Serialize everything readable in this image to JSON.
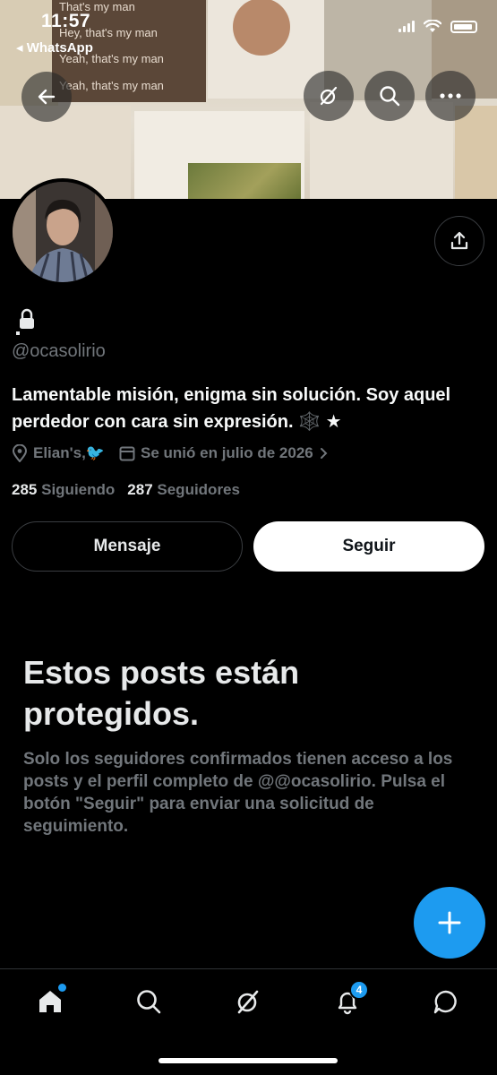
{
  "status_bar": {
    "time": "11:57",
    "back_app": "◂ WhatsApp"
  },
  "banner": {
    "chat_lines": [
      "That's my man",
      "Hey, that's my man",
      "Yeah, that's my man",
      "Yeah, that's my man"
    ]
  },
  "profile": {
    "handle": "@ocasolirio",
    "bio": "Lamentable misión, enigma sin solución. Soy aquel perdedor con cara sin expresión. 🕸️ ★",
    "location": "Elian's,🐦",
    "joined": "Se unió en julio de 2026",
    "following_count": "285",
    "following_label": "Siguiendo",
    "followers_count": "287",
    "followers_label": "Seguidores"
  },
  "actions": {
    "message_label": "Mensaje",
    "follow_label": "Seguir"
  },
  "protected": {
    "title": "Estos posts están protegidos.",
    "text": "Solo los seguidores confirmados tienen acceso a los posts y el perfil completo de @@ocasolirio. Pulsa el botón \"Seguir\" para enviar una solicitud de seguimiento."
  },
  "nav": {
    "notifications_badge": "4"
  },
  "colors": {
    "accent": "#1d9bf0",
    "background": "#000000",
    "muted_text": "#71767b"
  },
  "icons": [
    "back-arrow-icon",
    "grok-icon",
    "search-icon",
    "more-icon",
    "share-icon",
    "lock-icon",
    "location-icon",
    "calendar-icon",
    "chevron-right-icon",
    "plus-icon",
    "home-icon",
    "bell-icon",
    "messages-icon"
  ]
}
